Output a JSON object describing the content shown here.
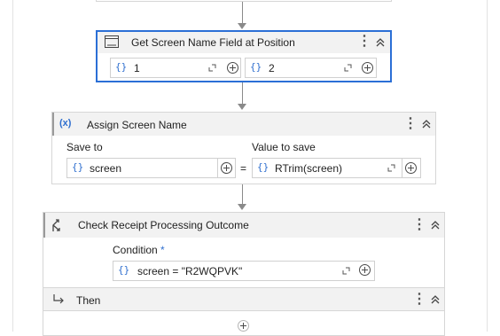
{
  "activity_get_field": {
    "title": "Get Screen Name Field at Position",
    "field_x_value": "1",
    "field_y_value": "2"
  },
  "activity_assign": {
    "title": "Assign Screen Name",
    "save_to_label": "Save to",
    "save_to_value": "screen",
    "equals": "=",
    "value_label": "Value to save",
    "value_value": "RTrim(screen)"
  },
  "activity_if": {
    "title": "Check Receipt Processing Outcome",
    "condition_label": "Condition",
    "required_marker": "*",
    "condition_value": "screen = \"R2WQPVK\"",
    "then_label": "Then"
  },
  "glyphs": {
    "braces": "{}",
    "more": "⋮",
    "assign_icon_text": "(x)"
  },
  "colors": {
    "selected_border": "#2b6fd6",
    "accent_blue": "#2f6fcf",
    "header_bg": "#f2f2f2"
  },
  "icons": [
    "window-icon",
    "assign-icon",
    "if-branch-icon",
    "then-branch-icon",
    "collapse-icon",
    "more-icon",
    "expand-editor-icon",
    "add-variable-icon",
    "add-activity-icon"
  ]
}
